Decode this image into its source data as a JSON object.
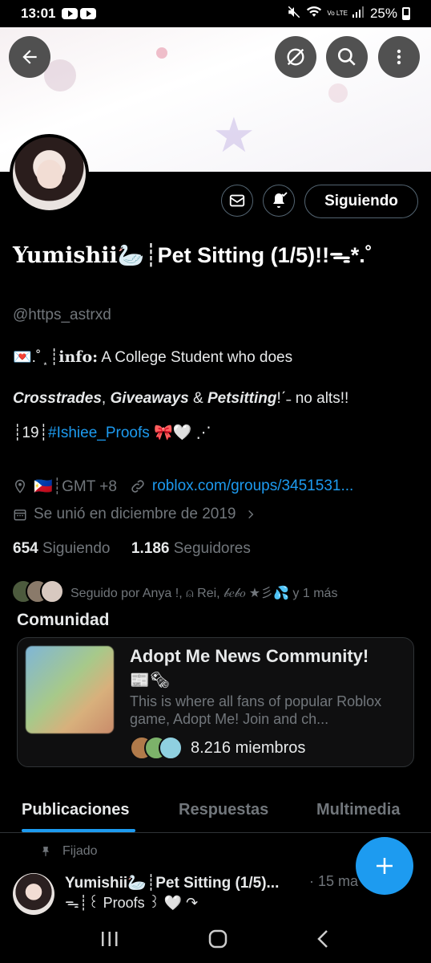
{
  "status_bar": {
    "time": "13:01",
    "network": "Vo LTE",
    "battery": "25%"
  },
  "header_buttons": {
    "back": "back-arrow-icon",
    "translate": "translate-off-icon",
    "search": "search-icon",
    "more": "more-vertical-icon"
  },
  "profile": {
    "name_serif": "Yumishii",
    "name_emoji": "🦢",
    "name_rest": "┊Pet Sitting (1/5)!!",
    "name_suffix": "ᯓ*.˚",
    "follow_button": "Siguiendo",
    "handle": "@https_astrxd",
    "bio_line1_prefix": "💌.˚ ͙ ┊",
    "bio_line1_info": "info:",
    "bio_line1_rest": " A College Student who does",
    "bio_line2_a": "Crosstrades",
    "bio_line2_sep1": ", ",
    "bio_line2_b": "Giveaways",
    "bio_line2_sep2": " & ",
    "bio_line2_c": "Petsitting",
    "bio_line2_rest": "!ˊ˗ no alts!!",
    "bio_line3_prefix": "┊19┊",
    "bio_line3_tag": "#Ishiee_Proofs",
    "bio_line3_suffix": " 🎀🤍 ⋰",
    "location": "🇵🇭┊GMT +8",
    "link": "roblox.com/groups/3451531...",
    "joined": "Se unió en diciembre de 2019",
    "following_count": "654",
    "following_label": "Siguiendo",
    "followers_count": "1.186",
    "followers_label": "Seguidores",
    "followed_by": "Seguido por Anya !, ⍝ Rei, 𝒷𝑒𝒷𝑜 ★彡💦 y 1 más"
  },
  "community": {
    "section_title": "Comunidad",
    "name": "Adopt Me News Community!",
    "name_emoji": "📰🗞",
    "description": "This is where all fans of popular Roblox game, Adopt Me! Join and ch...",
    "members": "8.216 miembros"
  },
  "tabs": [
    {
      "label": "Publicaciones",
      "active": true
    },
    {
      "label": "Respuestas",
      "active": false
    },
    {
      "label": "Multimedia",
      "active": false
    }
  ],
  "pinned_post": {
    "pinned_label": "Fijado",
    "author": "Yumishii🦢┊Pet Sitting (1/5)...",
    "time": "· 15 ma",
    "line2": "ᯓ┊꒰ Proofs ꒱ 🤍 ↷"
  },
  "colors": {
    "accent": "#1d9bf0",
    "background": "#000000",
    "muted": "#71767b",
    "text": "#e7e9ea",
    "border": "#2f3336"
  }
}
